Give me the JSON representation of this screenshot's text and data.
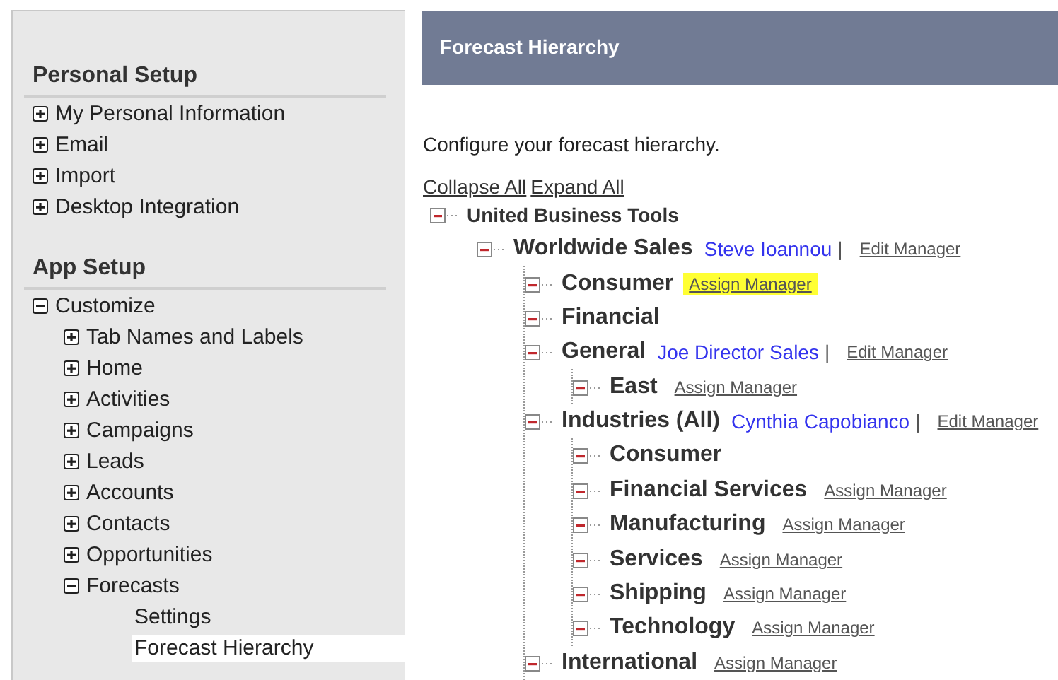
{
  "sidebar": {
    "sections": [
      {
        "title": "Personal Setup",
        "items": [
          {
            "label": "My Personal Information",
            "expanded": false,
            "selected": false
          },
          {
            "label": "Email",
            "expanded": false,
            "selected": false
          },
          {
            "label": "Import",
            "expanded": false,
            "selected": false
          },
          {
            "label": "Desktop Integration",
            "expanded": false,
            "selected": false
          }
        ]
      },
      {
        "title": "App Setup",
        "items": [
          {
            "label": "Customize",
            "expanded": true,
            "selected": false,
            "children": [
              {
                "label": "Tab Names and Labels",
                "expanded": false,
                "selected": false
              },
              {
                "label": "Home",
                "expanded": false,
                "selected": false
              },
              {
                "label": "Activities",
                "expanded": false,
                "selected": false
              },
              {
                "label": "Campaigns",
                "expanded": false,
                "selected": false
              },
              {
                "label": "Leads",
                "expanded": false,
                "selected": false
              },
              {
                "label": "Accounts",
                "expanded": false,
                "selected": false
              },
              {
                "label": "Contacts",
                "expanded": false,
                "selected": false
              },
              {
                "label": "Opportunities",
                "expanded": false,
                "selected": false
              },
              {
                "label": "Forecasts",
                "expanded": true,
                "selected": false,
                "children": [
                  {
                    "label": "Settings",
                    "selected": false
                  },
                  {
                    "label": "Forecast Hierarchy",
                    "selected": true
                  }
                ]
              }
            ]
          }
        ]
      }
    ]
  },
  "page": {
    "title": "Forecast Hierarchy",
    "intro": "Configure your forecast hierarchy.",
    "actions": [
      "Collapse All",
      "Expand All"
    ]
  },
  "tree": [
    {
      "name": "United Business Tools",
      "expanded": true,
      "children": [
        {
          "name": "Worldwide Sales",
          "expanded": true,
          "manager": "Steve Ioannou",
          "separator": "|",
          "link": {
            "text": "Edit Manager",
            "highlighted": false
          },
          "children": [
            {
              "name": "Consumer",
              "expanded": true,
              "link": {
                "text": "Assign Manager",
                "highlighted": true
              }
            },
            {
              "name": "Financial",
              "expanded": true
            },
            {
              "name": "General",
              "expanded": true,
              "manager": "Joe Director Sales",
              "separator": "|",
              "link": {
                "text": "Edit Manager",
                "highlighted": false
              },
              "children": [
                {
                  "name": "East",
                  "expanded": true,
                  "link": {
                    "text": "Assign Manager",
                    "highlighted": false
                  }
                }
              ]
            },
            {
              "name": "Industries (All)",
              "expanded": true,
              "manager": "Cynthia Capobianco",
              "separator": "|",
              "link": {
                "text": "Edit Manager",
                "highlighted": false
              },
              "children": [
                {
                  "name": "Consumer",
                  "expanded": true
                },
                {
                  "name": "Financial Services",
                  "expanded": true,
                  "link": {
                    "text": "Assign Manager",
                    "highlighted": false
                  }
                },
                {
                  "name": "Manufacturing",
                  "expanded": true,
                  "link": {
                    "text": "Assign Manager",
                    "highlighted": false
                  }
                },
                {
                  "name": "Services",
                  "expanded": true,
                  "link": {
                    "text": "Assign Manager",
                    "highlighted": false
                  }
                },
                {
                  "name": "Shipping",
                  "expanded": true,
                  "link": {
                    "text": "Assign Manager",
                    "highlighted": false
                  }
                },
                {
                  "name": "Technology",
                  "expanded": true,
                  "link": {
                    "text": "Assign Manager",
                    "highlighted": false
                  }
                }
              ]
            },
            {
              "name": "International",
              "expanded": true,
              "link": {
                "text": "Assign Manager",
                "highlighted": false
              }
            }
          ]
        }
      ]
    }
  ]
}
